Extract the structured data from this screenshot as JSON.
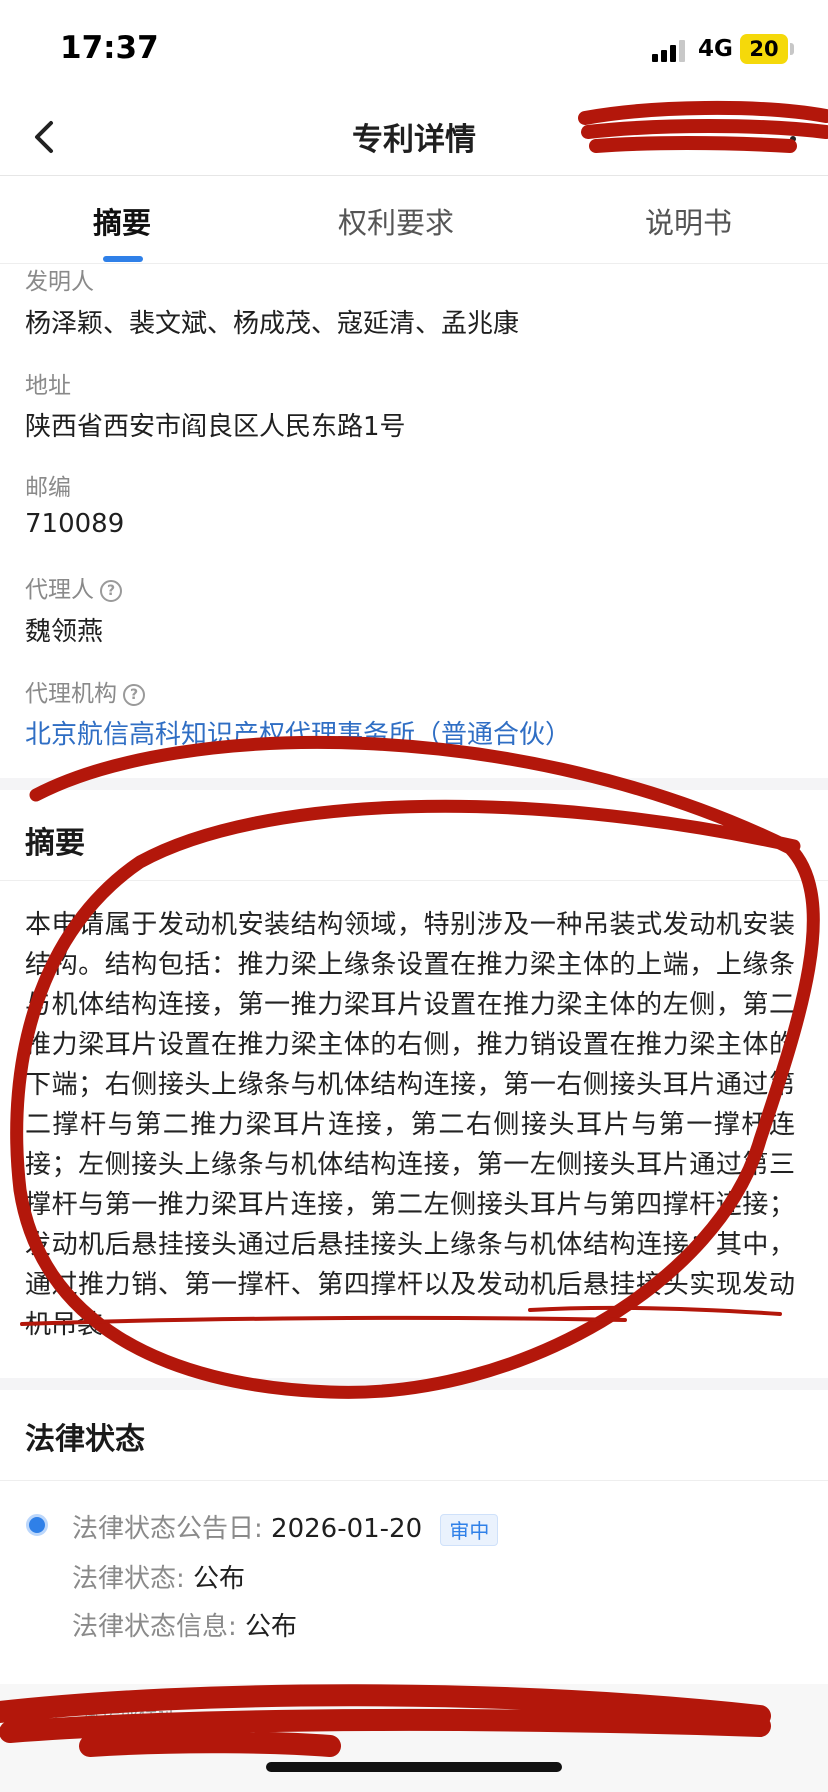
{
  "status_bar": {
    "time": "17:37",
    "network": "4G",
    "battery": "20"
  },
  "nav": {
    "title": "专利详情"
  },
  "tabs": [
    {
      "label": "摘要",
      "active": true
    },
    {
      "label": "权利要求",
      "active": false
    },
    {
      "label": "说明书",
      "active": false
    }
  ],
  "fields": {
    "inventor": {
      "label": "发明人",
      "value": "杨泽颖、裴文斌、杨成茂、寇延清、孟兆康"
    },
    "address": {
      "label": "地址",
      "value": "陕西省西安市阎良区人民东路1号"
    },
    "postcode": {
      "label": "邮编",
      "value": "710089"
    },
    "agent": {
      "label": "代理人",
      "value": "魏领燕"
    },
    "agency": {
      "label": "代理机构",
      "value": "北京航信高科知识产权代理事务所（普通合伙）"
    }
  },
  "abstract": {
    "title": "摘要",
    "text": "本申请属于发动机安装结构领域，特别涉及一种吊装式发动机安装结构。结构包括：推力梁上缘条设置在推力梁主体的上端，上缘条与机体结构连接，第一推力梁耳片设置在推力梁主体的左侧，第二推力梁耳片设置在推力梁主体的右侧，推力销设置在推力梁主体的下端；右侧接头上缘条与机体结构连接，第一右侧接头耳片通过第二撑杆与第二推力梁耳片连接，第二右侧接头耳片与第一撑杆连接；左侧接头上缘条与机体结构连接，第一左侧接头耳片通过第三撑杆与第一推力梁耳片连接，第二左侧接头耳片与第四撑杆连接；发动机后悬挂接头通过后悬挂接头上缘条与机体结构连接；其中，通过推力销、第一撑杆、第四撑杆以及发动机后悬挂接头实现发动机吊装。"
  },
  "legal": {
    "title": "法律状态",
    "date_label": "法律状态公告日:",
    "date_value": "2026-01-20",
    "badge": "审中",
    "status_label": "法律状态:",
    "status_value": "公布",
    "info_label": "法律状态信息:",
    "info_value": "公布"
  },
  "footer": {
    "text": "建议、承诺或保证"
  },
  "colors": {
    "accent": "#2f80e8",
    "link": "#2f6ec4",
    "scribble": "#b3170b"
  },
  "icons": {
    "back": "chevron-left-icon",
    "more": "more-dots-icon",
    "help": "question-circle-icon"
  }
}
